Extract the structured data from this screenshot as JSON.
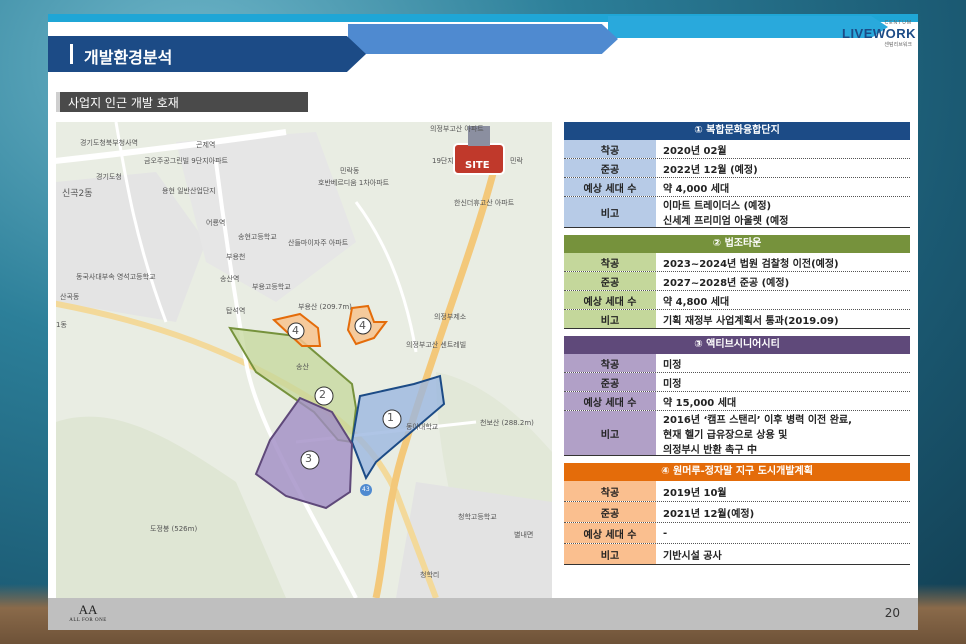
{
  "header": {
    "title": "개발환경분석",
    "logo_small": "CENTUM",
    "logo_main": "LIVEWORK",
    "logo_sub": "센텀리브워크"
  },
  "section": {
    "subtitle": "사업지 인근 개발 호재"
  },
  "map": {
    "site_label": "SITE",
    "labels": [
      "경기도청북부청사역",
      "곤제역",
      "금오주공그린빌 9단지아파트",
      "경기도청",
      "신곡2동",
      "용현 일반산업단지",
      "어룡역",
      "송현고등학교",
      "호반베르디움 1차아파트",
      "산들마이자주 아파트",
      "부용천",
      "송산역",
      "부용고등학교",
      "탑석역",
      "부용산 (209.7m)",
      "의정부고산 센트레빌",
      "의정부제소",
      "송산",
      "동아대학교",
      "천보산 (288.2m)",
      "청학고등학교",
      "동국사대부속 영석고등학교",
      "도정봉 (526m)",
      "별내면",
      "청학리",
      "1동",
      "민락동",
      "의정부고산 아파트",
      "한신더휴고산 아파트",
      "19단지",
      "민락",
      "산곡동"
    ],
    "zones": [
      "1",
      "2",
      "3",
      "4",
      "4"
    ],
    "road_marker": "43"
  },
  "tables": [
    {
      "title": "① 복합문화융합단지",
      "head_color": "#1c4b86",
      "label_color": "#b7cbe7",
      "rows": [
        {
          "label": "착공",
          "value": [
            "2020년 02월"
          ]
        },
        {
          "label": "준공",
          "value": [
            "2022년 12월 (예정)"
          ]
        },
        {
          "label": "예상 세대 수",
          "value": [
            "약 4,000 세대"
          ]
        },
        {
          "label": "비고",
          "value": [
            "이마트 트레이더스 (예정)",
            "신세계 프리미엄 아울렛 (예정"
          ]
        }
      ]
    },
    {
      "title": "② 법조타운",
      "head_color": "#76923c",
      "label_color": "#c4d79b",
      "rows": [
        {
          "label": "착공",
          "value": [
            "2023~2024년 법원 검찰청 이전(예정)"
          ]
        },
        {
          "label": "준공",
          "value": [
            "2027~2028년 준공 (예정)"
          ]
        },
        {
          "label": "예상 세대 수",
          "value": [
            "약 4,800 세대"
          ]
        },
        {
          "label": "비고",
          "value": [
            "기획 재정부 사업계획서 통과(2019.09)"
          ]
        }
      ]
    },
    {
      "title": "③ 액티브시니어시티",
      "head_color": "#5f497a",
      "label_color": "#b1a0c7",
      "rows": [
        {
          "label": "착공",
          "value": [
            "미정"
          ]
        },
        {
          "label": "준공",
          "value": [
            "미정"
          ]
        },
        {
          "label": "예상 세대 수",
          "value": [
            "약 15,000 세대"
          ]
        },
        {
          "label": "비고",
          "value": [
            "2016년 ‘캠프 스탠리’ 이후 병력 이전 완료,",
            "현재 헬기 급유장으로 상용 및",
            "의정부시 반환 촉구 中"
          ]
        }
      ]
    },
    {
      "title": "④ 원머루-정자말 지구 도시개발계획",
      "head_color": "#e46c0a",
      "label_color": "#fabf8f",
      "rows": [
        {
          "label": "착공",
          "value": [
            "2019년 10월"
          ]
        },
        {
          "label": "준공",
          "value": [
            "2021년 12월(예정)"
          ]
        },
        {
          "label": "예상 세대 수",
          "value": [
            "-"
          ]
        },
        {
          "label": "비고",
          "value": [
            "기반시설 공사"
          ]
        }
      ]
    }
  ],
  "footer": {
    "page": "20",
    "logo_mark": "AA",
    "logo_text": "ALL FOR ONE"
  }
}
